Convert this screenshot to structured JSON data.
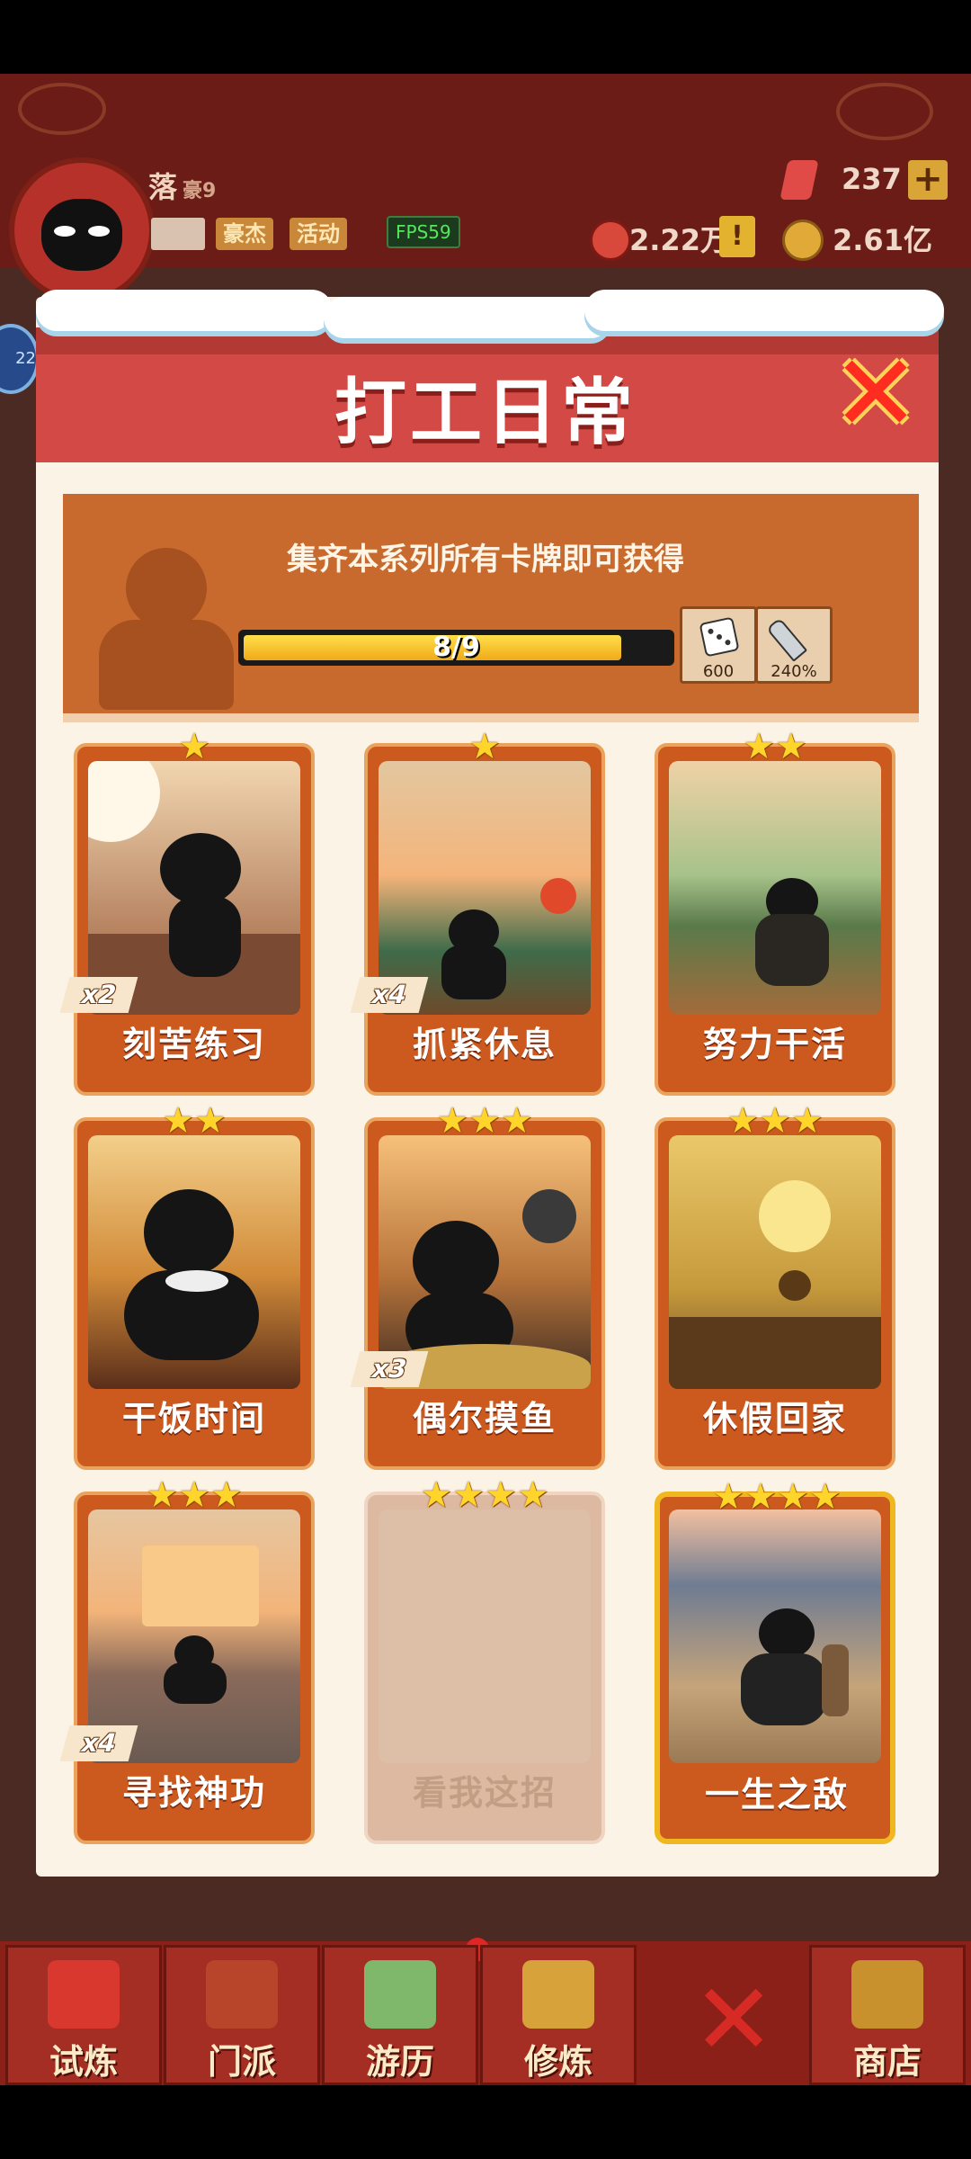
{
  "header": {
    "player_name": "落",
    "player_rank": "豪9",
    "tags": [
      "豪杰",
      "活动"
    ],
    "fps": "FPS59",
    "gems": "237",
    "silver": "2.22万",
    "gold": "2.61亿",
    "side_badge": "22"
  },
  "dialog": {
    "title": "打工日常",
    "banner_text": "集齐本系列所有卡牌即可获得",
    "progress_text": "8/9",
    "progress": 0.889,
    "rewards": [
      {
        "icon": "dice-icon",
        "value": "600"
      },
      {
        "icon": "sword-icon",
        "value": "240%"
      }
    ]
  },
  "cards": [
    {
      "name": "刻苦练习",
      "stars": "★",
      "count": "x2"
    },
    {
      "name": "抓紧休息",
      "stars": "★",
      "count": "x4"
    },
    {
      "name": "努力干活",
      "stars": "★★",
      "count": ""
    },
    {
      "name": "干饭时间",
      "stars": "★★",
      "count": ""
    },
    {
      "name": "偶尔摸鱼",
      "stars": "★★★",
      "count": "x3"
    },
    {
      "name": "休假回家",
      "stars": "★★★",
      "count": ""
    },
    {
      "name": "寻找神功",
      "stars": "★★★",
      "count": "x4"
    },
    {
      "name": "看我这招",
      "stars": "★★★★",
      "count": ""
    },
    {
      "name": "一生之敌",
      "stars": "★★★★",
      "count": ""
    }
  ],
  "nav": {
    "items": [
      "试炼",
      "门派",
      "游历",
      "修炼",
      "商店"
    ]
  },
  "colors": {
    "accent_red": "#d34945",
    "card_orange": "#cc5a1f",
    "star_gold": "#ffd52c"
  }
}
